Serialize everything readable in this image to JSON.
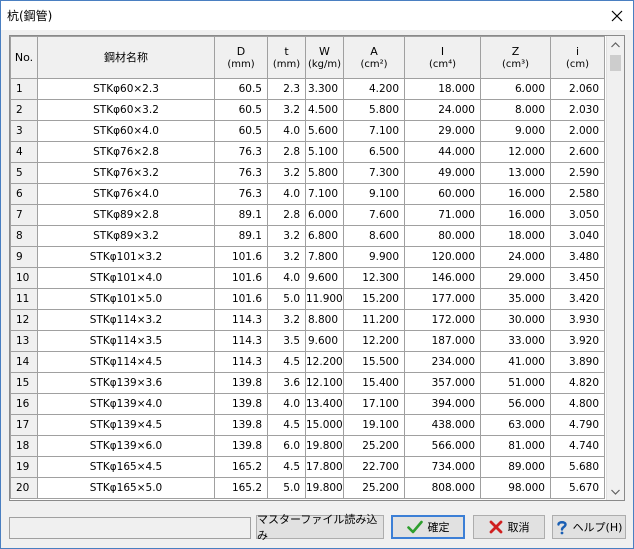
{
  "window": {
    "title": "杭(鋼管)"
  },
  "table": {
    "headers": [
      {
        "label": "No.",
        "unit": ""
      },
      {
        "label": "鋼材名称",
        "unit": ""
      },
      {
        "label": "D",
        "unit": "(mm)"
      },
      {
        "label": "t",
        "unit": "(mm)"
      },
      {
        "label": "W",
        "unit": "(kg/m)"
      },
      {
        "label": "A",
        "unit": "(cm²)"
      },
      {
        "label": "I",
        "unit": "(cm⁴)"
      },
      {
        "label": "Z",
        "unit": "(cm³)"
      },
      {
        "label": "i",
        "unit": "(cm)"
      }
    ],
    "rows": [
      [
        "1",
        "STKφ60×2.3",
        "60.5",
        "2.3",
        "3.300",
        "4.200",
        "18.000",
        "6.000",
        "2.060"
      ],
      [
        "2",
        "STKφ60×3.2",
        "60.5",
        "3.2",
        "4.500",
        "5.800",
        "24.000",
        "8.000",
        "2.030"
      ],
      [
        "3",
        "STKφ60×4.0",
        "60.5",
        "4.0",
        "5.600",
        "7.100",
        "29.000",
        "9.000",
        "2.000"
      ],
      [
        "4",
        "STKφ76×2.8",
        "76.3",
        "2.8",
        "5.100",
        "6.500",
        "44.000",
        "12.000",
        "2.600"
      ],
      [
        "5",
        "STKφ76×3.2",
        "76.3",
        "3.2",
        "5.800",
        "7.300",
        "49.000",
        "13.000",
        "2.590"
      ],
      [
        "6",
        "STKφ76×4.0",
        "76.3",
        "4.0",
        "7.100",
        "9.100",
        "60.000",
        "16.000",
        "2.580"
      ],
      [
        "7",
        "STKφ89×2.8",
        "89.1",
        "2.8",
        "6.000",
        "7.600",
        "71.000",
        "16.000",
        "3.050"
      ],
      [
        "8",
        "STKφ89×3.2",
        "89.1",
        "3.2",
        "6.800",
        "8.600",
        "80.000",
        "18.000",
        "3.040"
      ],
      [
        "9",
        "STKφ101×3.2",
        "101.6",
        "3.2",
        "7.800",
        "9.900",
        "120.000",
        "24.000",
        "3.480"
      ],
      [
        "10",
        "STKφ101×4.0",
        "101.6",
        "4.0",
        "9.600",
        "12.300",
        "146.000",
        "29.000",
        "3.450"
      ],
      [
        "11",
        "STKφ101×5.0",
        "101.6",
        "5.0",
        "11.900",
        "15.200",
        "177.000",
        "35.000",
        "3.420"
      ],
      [
        "12",
        "STKφ114×3.2",
        "114.3",
        "3.2",
        "8.800",
        "11.200",
        "172.000",
        "30.000",
        "3.930"
      ],
      [
        "13",
        "STKφ114×3.5",
        "114.3",
        "3.5",
        "9.600",
        "12.200",
        "187.000",
        "33.000",
        "3.920"
      ],
      [
        "14",
        "STKφ114×4.5",
        "114.3",
        "4.5",
        "12.200",
        "15.500",
        "234.000",
        "41.000",
        "3.890"
      ],
      [
        "15",
        "STKφ139×3.6",
        "139.8",
        "3.6",
        "12.100",
        "15.400",
        "357.000",
        "51.000",
        "4.820"
      ],
      [
        "16",
        "STKφ139×4.0",
        "139.8",
        "4.0",
        "13.400",
        "17.100",
        "394.000",
        "56.000",
        "4.800"
      ],
      [
        "17",
        "STKφ139×4.5",
        "139.8",
        "4.5",
        "15.000",
        "19.100",
        "438.000",
        "63.000",
        "4.790"
      ],
      [
        "18",
        "STKφ139×6.0",
        "139.8",
        "6.0",
        "19.800",
        "25.200",
        "566.000",
        "81.000",
        "4.740"
      ],
      [
        "19",
        "STKφ165×4.5",
        "165.2",
        "4.5",
        "17.800",
        "22.700",
        "734.000",
        "89.000",
        "5.680"
      ],
      [
        "20",
        "STKφ165×5.0",
        "165.2",
        "5.0",
        "19.800",
        "25.200",
        "808.000",
        "98.000",
        "5.670"
      ]
    ]
  },
  "buttons": {
    "master": "マスターファイル読み込み",
    "ok": "確定",
    "cancel": "取消",
    "help": "ヘルプ(H)"
  },
  "icons": {
    "close": "close-icon",
    "ok": "check-icon",
    "cancel": "x-icon",
    "help": "question-icon"
  },
  "colors": {
    "check": "#2e9e2e",
    "cross": "#d01f1f",
    "help": "#1a5fb4",
    "focus_border": "#3c7fd6"
  }
}
